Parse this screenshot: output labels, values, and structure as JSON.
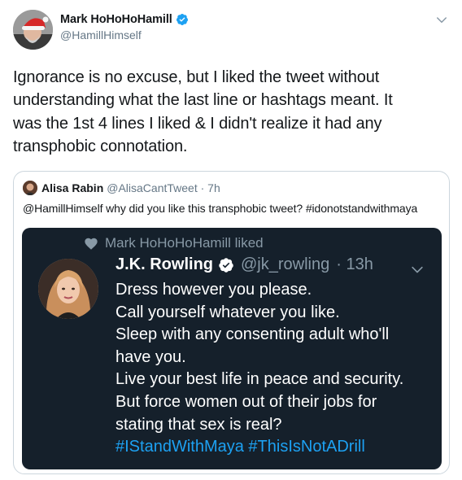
{
  "tweet": {
    "display_name": "Mark HoHoHoHamill",
    "handle": "@HamillHimself",
    "text_lines": [
      "Ignorance is no excuse, but I liked the tweet without",
      "understanding what the last line or hashtags meant. It",
      "was the 1st 4 lines I liked & I didn't realize it had any",
      "transphobic connotation."
    ],
    "avatar_icon": "avatar-santa-hat",
    "verified_icon": "verified-badge-icon",
    "menu_icon": "chevron-down-icon"
  },
  "quote": {
    "display_name": "Alisa Rabin",
    "handle_time": "@AlisaCantTweet · 7h",
    "text": "@HamillHimself why did you like this transphobic tweet? #idonotstandwithmaya"
  },
  "embedded": {
    "liked_text": "Mark HoHoHoHamill liked",
    "display_name": "J.K. Rowling",
    "handle": "@jk_rowling",
    "time": "· 13h",
    "lines": [
      "Dress however you please.",
      "Call yourself whatever you like.",
      "Sleep with any consenting adult who'll",
      "have you.",
      "Live your best life in peace and security.",
      "But force women out of their jobs for",
      "stating that sex is real?"
    ],
    "hashtags": "#IStandWithMaya #ThisIsNotADrill",
    "background": "#15202b",
    "link_color": "#1da1f2"
  },
  "colors": {
    "text": "#14171a",
    "secondary": "#657786",
    "verified": "#1da1f2",
    "border": "#ccd6dd"
  }
}
